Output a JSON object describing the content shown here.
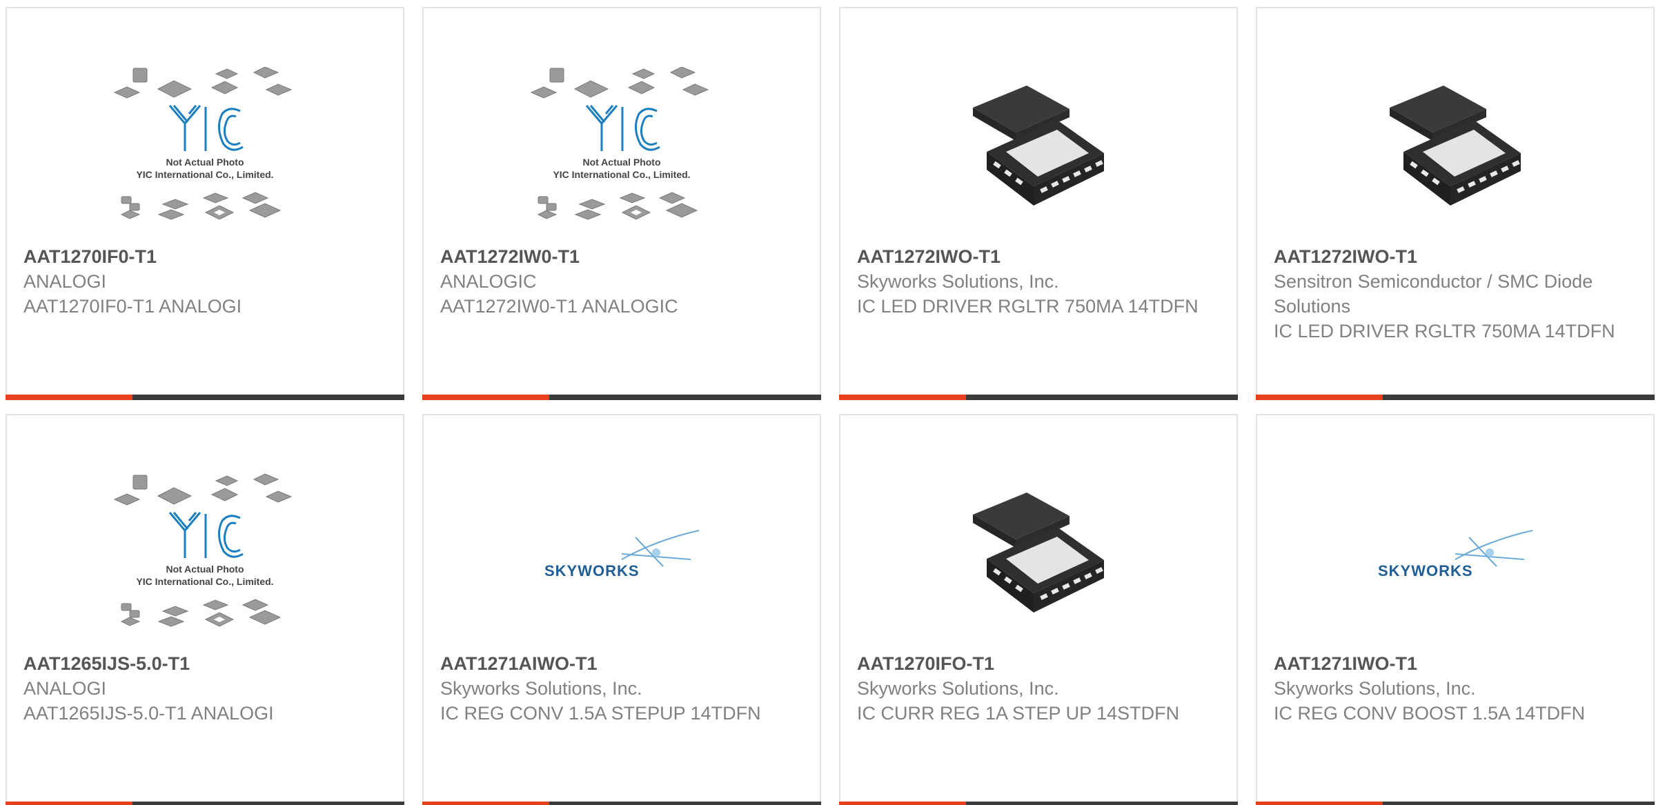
{
  "products": [
    {
      "part_number": "AAT1270IF0-T1",
      "manufacturer": "ANALOGI",
      "description": "AAT1270IF0-T1 ANALOGI",
      "image": "yic-placeholder-image"
    },
    {
      "part_number": "AAT1272IW0-T1",
      "manufacturer": "ANALOGIC",
      "description": "AAT1272IW0-T1 ANALOGIC",
      "image": "yic-placeholder-image"
    },
    {
      "part_number": "AAT1272IWO-T1",
      "manufacturer": "Skyworks Solutions, Inc.",
      "description": "IC LED DRIVER RGLTR 750MA 14TDFN",
      "image": "tdfn-chip-image"
    },
    {
      "part_number": "AAT1272IWO-T1",
      "manufacturer": "Sensitron Semiconductor / SMC Diode Solutions",
      "description": "IC LED DRIVER RGLTR 750MA 14TDFN",
      "image": "tdfn-chip-image"
    },
    {
      "part_number": "AAT1265IJS-5.0-T1",
      "manufacturer": "ANALOGI",
      "description": "AAT1265IJS-5.0-T1 ANALOGI",
      "image": "yic-placeholder-image"
    },
    {
      "part_number": "AAT1271AIWO-T1",
      "manufacturer": "Skyworks Solutions, Inc.",
      "description": "IC REG CONV 1.5A STEPUP 14TDFN",
      "image": "skyworks-logo"
    },
    {
      "part_number": "AAT1270IFO-T1",
      "manufacturer": "Skyworks Solutions, Inc.",
      "description": "IC CURR REG 1A STEP UP 14STDFN",
      "image": "tdfn-chip-image"
    },
    {
      "part_number": "AAT1271IWO-T1",
      "manufacturer": "Skyworks Solutions, Inc.",
      "description": "IC REG CONV BOOST 1.5A 14TDFN",
      "image": "skyworks-logo"
    }
  ],
  "placeholder": {
    "caption_line1": "Not Actual Photo",
    "caption_line2": "YIC International Co., Limited.",
    "logo_text": "YIC"
  },
  "brand_logo_text": "SKYWORKS",
  "colors": {
    "accent": "#e8401c",
    "bar": "#3b3b3b",
    "part_number": "#555555",
    "text": "#808080",
    "yic_blue": "#1a7fc1",
    "skyworks_blue": "#1f5d96"
  }
}
